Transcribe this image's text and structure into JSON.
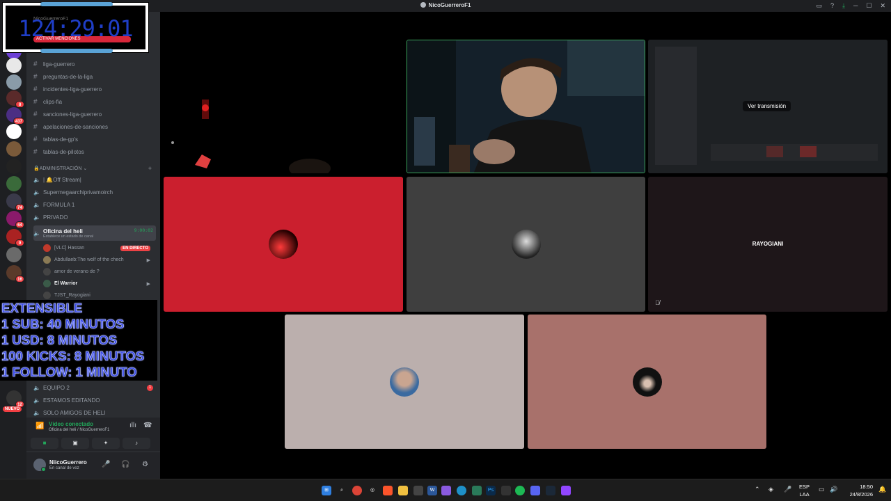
{
  "window": {
    "title": "NicoGuerreroF1"
  },
  "timer": {
    "value": "124:29:01",
    "behind_label": "NicoGuerreroF1",
    "behind_bar": "ACTIVAR MENCIONES"
  },
  "channels": {
    "text": [
      "liga-guerrero",
      "preguntas-de-la-liga",
      "incidentes-liga-guerrero",
      "clips-fia",
      "sanciones-liga-guerrero",
      "apelaciones-de-sanciones",
      "tablas-de-gp's",
      "tablas-de-pilotos"
    ],
    "category": "🔒ADMINISTRACIÓN",
    "voice": [
      "| 🔔Off Stream|",
      "Supermegaarchiprivamoirch",
      "FORMULA 1",
      "PRIVADO"
    ],
    "selected": {
      "name": "Oficina del heli",
      "time": "9:00:02",
      "status": "Establece un estado de canal"
    },
    "members": [
      {
        "name": "[VLC] Hassan",
        "live": "EN DIRECTO",
        "color": "#c0392b"
      },
      {
        "name": "Abdullaeb:The wolf of the chech",
        "color": "#8a7a55"
      },
      {
        "name": "amor de verano de ?",
        "color": "#444"
      },
      {
        "name": "El Warrior",
        "color": "#3a5a48"
      },
      {
        "name": "TJST_Rayogiani",
        "color": "#444"
      }
    ],
    "lower": [
      "EQUIPO 2",
      "ESTAMOS EDITANDO",
      "SOLO AMIGOS DE HELI"
    ],
    "lower_badge": "1"
  },
  "promo": [
    "EXTENSIBLE",
    "1 SUB: 40 MINUTOS",
    "1 USD: 8 MINUTOS",
    "100 KICKS: 8 MINUTOS",
    "1 FOLLOW: 1 MINUTO"
  ],
  "servers": [
    {
      "badge": "",
      "color": "#6b3fd4"
    },
    {
      "badge": "",
      "color": "#e8e8e8"
    },
    {
      "badge": "",
      "color": "#8a9ba8"
    },
    {
      "badge": "8",
      "color": "#5a2a2a"
    },
    {
      "badge": "437",
      "color": "#4b2e83"
    },
    {
      "badge": "",
      "color": "#ffffff"
    },
    {
      "badge": "",
      "color": "#7a5a3a"
    },
    {
      "badge": "",
      "color": "#222222"
    },
    {
      "badge": "",
      "color": "#3a6a3a"
    },
    {
      "badge": "74",
      "color": "#3a3a4a"
    },
    {
      "badge": "64",
      "color": "#8a1a6a"
    },
    {
      "badge": "9",
      "color": "#aa2222"
    },
    {
      "badge": "",
      "color": "#6a6a6a"
    },
    {
      "badge": "16",
      "color": "#5a3a2a"
    }
  ],
  "rail_bottom": {
    "badge": "12",
    "new_label": "NUEVO"
  },
  "voice_panel": {
    "status": "Vídeo conectado",
    "location": "Oficina del heli / NicoGuerreroF1"
  },
  "user": {
    "name": "NiicoGuerrero",
    "status": "En canal de voz"
  },
  "tiles": {
    "stream_label": "Ver transmisión",
    "rayo_name": "RAYOGIANI"
  },
  "taskbar": {
    "lang1": "ESP",
    "lang2": "LAA",
    "time": "18:50",
    "date": "24/8/2026"
  }
}
